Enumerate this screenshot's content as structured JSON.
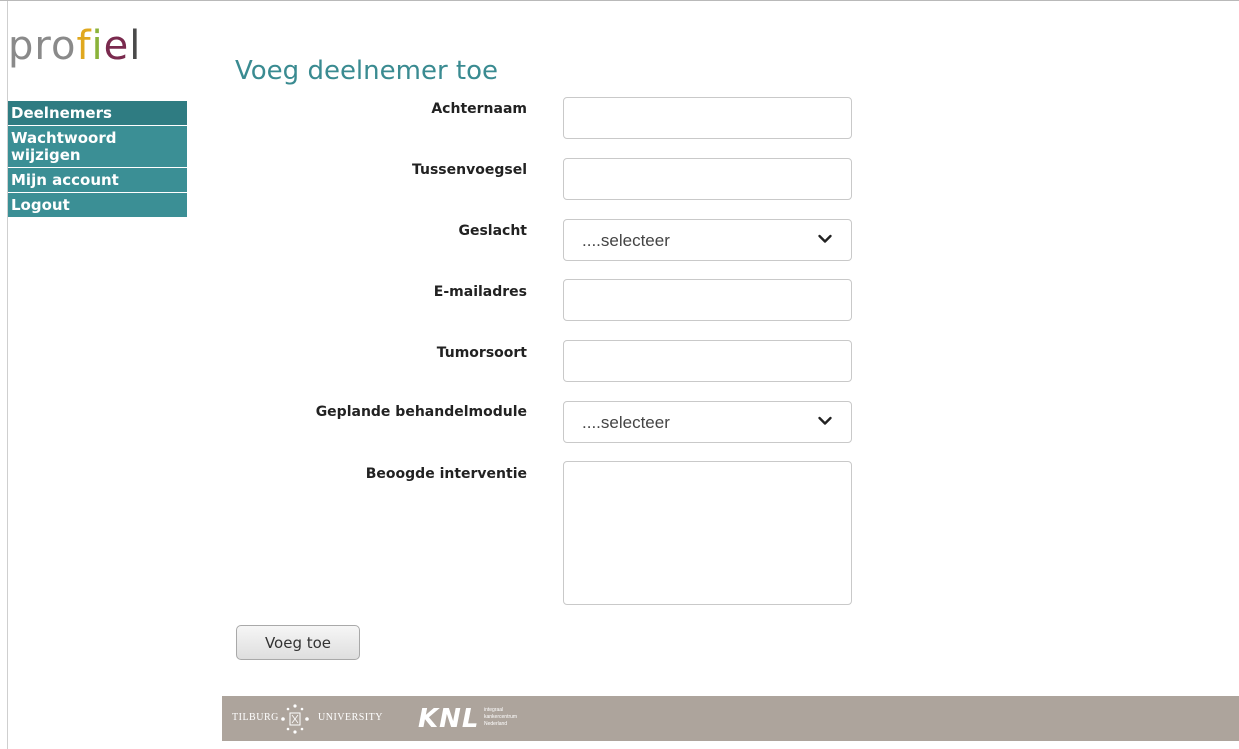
{
  "logo": {
    "p1": "pro",
    "p2": "f",
    "p3": "i",
    "p4": "e",
    "p5": "l"
  },
  "nav": {
    "items": [
      {
        "label": "Deelnemers"
      },
      {
        "label": "Wachtwoord wijzigen"
      },
      {
        "label": "Mijn account"
      },
      {
        "label": "Logout"
      }
    ]
  },
  "page": {
    "title": "Voeg deelnemer toe"
  },
  "form": {
    "achternaam": {
      "label": "Achternaam",
      "value": ""
    },
    "tussenvoegsel": {
      "label": "Tussenvoegsel",
      "value": ""
    },
    "geslacht": {
      "label": "Geslacht",
      "selected": "....selecteer"
    },
    "email": {
      "label": "E-mailadres",
      "value": ""
    },
    "tumorsoort": {
      "label": "Tumorsoort",
      "value": ""
    },
    "behandelmodule": {
      "label": "Geplande behandelmodule",
      "selected": "....selecteer"
    },
    "interventie": {
      "label": "Beoogde interventie",
      "value": ""
    },
    "submit_label": "Voeg toe"
  },
  "footer": {
    "tilburg": "TILBURG",
    "university": "UNIVERSITY",
    "knl": "KNL",
    "knl_sub1": "integraal",
    "knl_sub2": "kankercentrum",
    "knl_sub3": "Nederland"
  }
}
